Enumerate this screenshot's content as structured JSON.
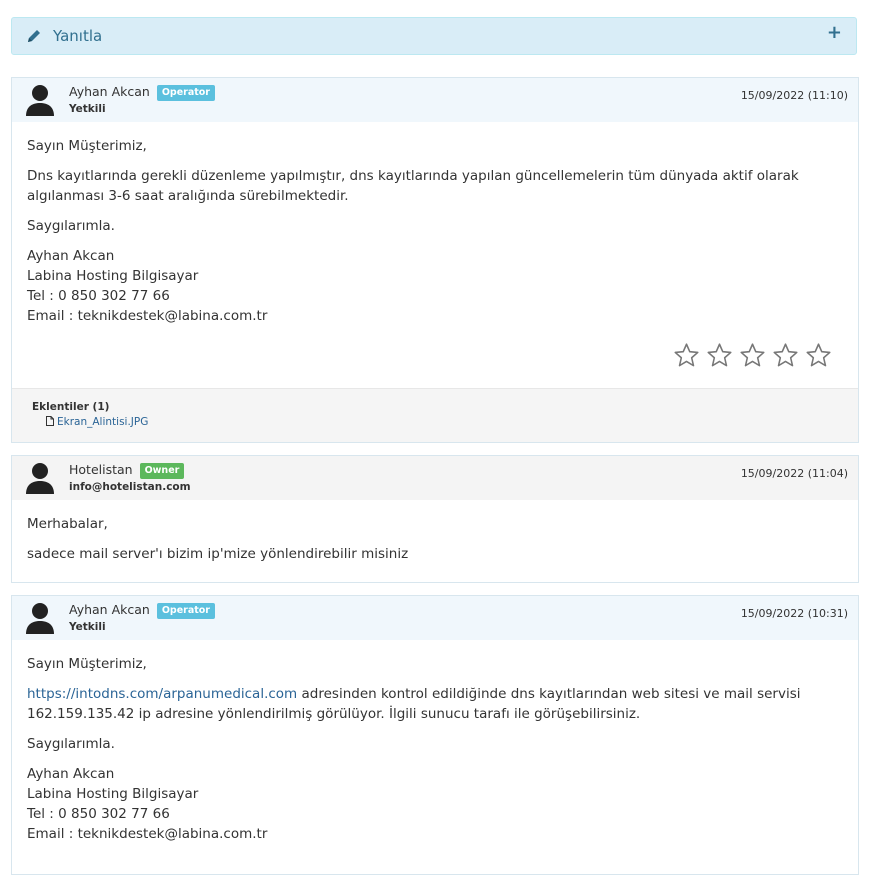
{
  "reply_bar": {
    "label": "Yanıtla",
    "expand_symbol": "+"
  },
  "messages": [
    {
      "author": "Ayhan Akcan",
      "badge": "Operator",
      "role": "Yetkili",
      "date": "15/09/2022 (11:10)",
      "paragraphs": [
        "Sayın Müşterimiz,",
        "Dns kayıtlarında gerekli düzenleme yapılmıştır, dns kayıtlarında yapılan güncellemelerin tüm dünyada aktif olarak algılanması 3-6 saat aralığında sürebilmektedir.",
        "Saygılarımla."
      ],
      "signature": [
        "Ayhan Akcan",
        "Labina Hosting Bilgisayar",
        "Tel : 0 850 302 77 66",
        "Email : teknikdestek@labina.com.tr"
      ],
      "rating": {
        "stars_total": 5,
        "stars_filled": 0
      },
      "attachments_title": "Eklentiler (1)",
      "attachment_file": "Ekran_Alintisi.JPG"
    },
    {
      "author": "Hotelistan",
      "badge": "Owner",
      "role": "info@hotelistan.com",
      "date": "15/09/2022 (11:04)",
      "paragraphs": [
        "Merhabalar,",
        "sadece mail server'ı bizim ip'mize yönlendirebilir misiniz"
      ]
    },
    {
      "author": "Ayhan Akcan",
      "badge": "Operator",
      "role": "Yetkili",
      "date": "15/09/2022 (10:31)",
      "paragraphs": [
        "Sayın Müşterimiz,"
      ],
      "link": "https://intodns.com/arpanumedical.com",
      "link_rest": " adresinden kontrol edildiğinde dns kayıtlarından web sitesi ve mail servisi 162.159.135.42 ip adresine yönlendirilmiş görülüyor. İlgili sunucu tarafı ile görüşebilirsiniz.",
      "closing": "Saygılarımla.",
      "signature": [
        "Ayhan Akcan",
        "Labina Hosting Bilgisayar",
        "Tel : 0 850 302 77 66",
        "Email : teknikdestek@labina.com.tr"
      ]
    }
  ],
  "colors": {
    "operator_badge": "#5bc0de",
    "owner_badge": "#5cb85c",
    "reply_bar_bg": "#d9edf7",
    "link": "#2a6496"
  },
  "icons": [
    "pencil-icon",
    "plus-icon",
    "user-avatar-icon",
    "star-icon",
    "file-icon"
  ]
}
